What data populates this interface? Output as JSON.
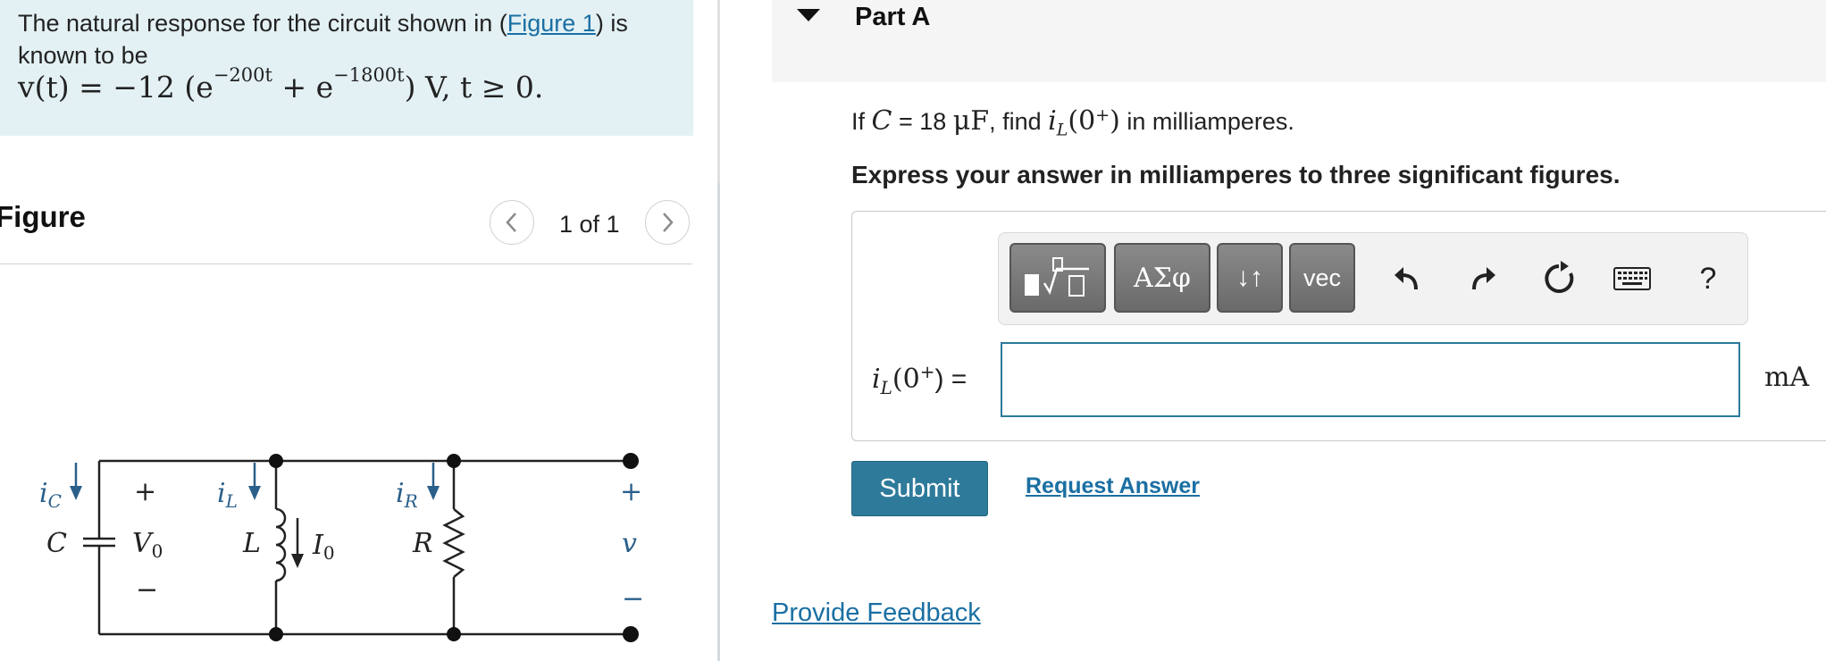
{
  "problem": {
    "intro": "The natural response for the circuit shown in (",
    "figure_link": "Figure 1",
    "intro_end": ") is known to be",
    "equation_lhs": "v(t) = −12 (e",
    "exp1": "−200t",
    "mid": " + e",
    "exp2": "−1800t",
    "equation_rhs": ")  V,    t ≥ 0."
  },
  "figure": {
    "title": "Figure",
    "counter": "1 of 1",
    "prev_icon": "chevron-left-icon",
    "next_icon": "chevron-right-icon",
    "labels": {
      "ic": "i",
      "ic_sub": "C",
      "C": "C",
      "plus": "+",
      "V0": "V",
      "V0_sub": "0",
      "minus": "−",
      "iL": "i",
      "iL_sub": "L",
      "L": "L",
      "I0": "I",
      "I0_sub": "0",
      "iR": "i",
      "iR_sub": "R",
      "R": "R",
      "vplus": "+",
      "v": "v",
      "vminus": "−"
    }
  },
  "part": {
    "title": "Part A",
    "question_pre": "If ",
    "question_C": "C",
    "question_eq": " = 18 ",
    "question_unit": "μF",
    "question_mid": ", find ",
    "question_iL": "i",
    "question_iL_sub": "L",
    "question_arg": "(0",
    "question_arg_sup": "+",
    "question_arg_end": ")",
    "question_end": " in milliamperes.",
    "instructions": "Express your answer in milliamperes to three significant figures."
  },
  "toolbar": {
    "greek_label": "ΑΣφ",
    "arrows_label": "↓↑",
    "vec_label": "vec",
    "help_label": "?",
    "icons": [
      "templates-icon",
      "undo-icon",
      "redo-icon",
      "reset-icon",
      "keyboard-icon"
    ]
  },
  "answer": {
    "label_i": "i",
    "label_sub": "L",
    "label_arg": "(0",
    "label_sup": "+",
    "label_end": ") =",
    "value": "",
    "unit": "mA"
  },
  "actions": {
    "submit": "Submit",
    "request": "Request Answer",
    "feedback": "Provide Feedback"
  },
  "colors": {
    "problem_bg": "#e3f1f4",
    "accent": "#2e7a9a",
    "link": "#1a6fa3"
  }
}
